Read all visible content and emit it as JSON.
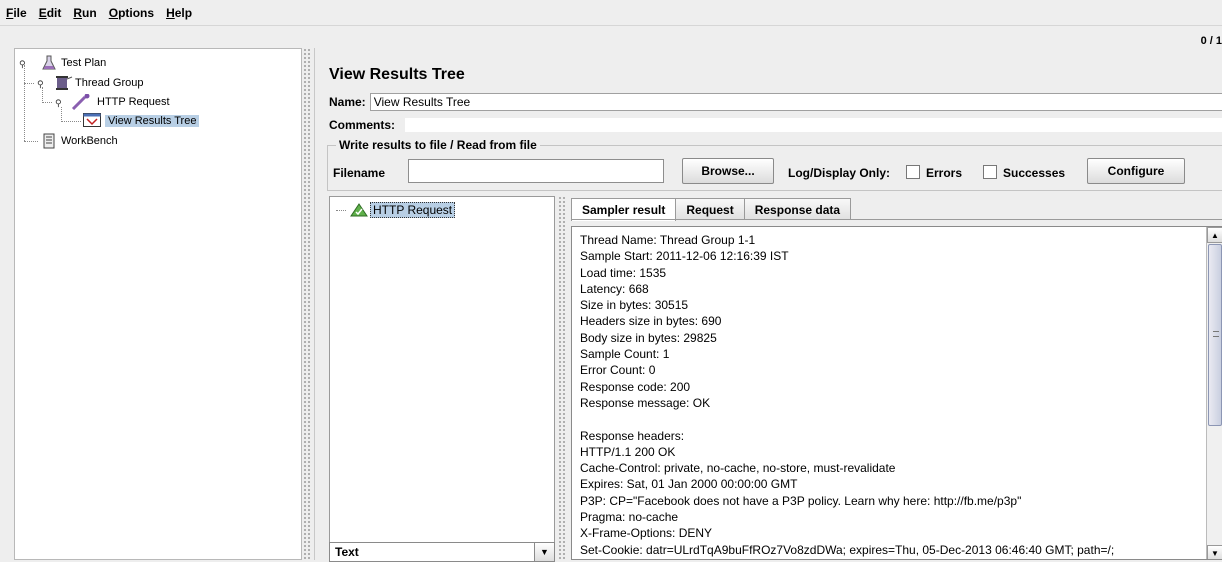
{
  "menu": [
    {
      "u": "F",
      "rest": "ile"
    },
    {
      "u": "E",
      "rest": "dit"
    },
    {
      "u": "R",
      "rest": "un"
    },
    {
      "u": "O",
      "rest": "ptions"
    },
    {
      "u": "H",
      "rest": "elp"
    }
  ],
  "status": "0 / 1",
  "tree": {
    "test_plan": "Test Plan",
    "thread_group": "Thread Group",
    "http_request": "HTTP Request",
    "view_results_tree": "View Results Tree",
    "workbench": "WorkBench"
  },
  "panel": {
    "title": "View Results Tree",
    "name_label": "Name:",
    "name_value": "View Results Tree",
    "comments_label": "Comments:",
    "file_legend": "Write results to file / Read from file",
    "filename_label": "Filename",
    "browse": "Browse...",
    "log_display": "Log/Display Only:",
    "errors": "Errors",
    "successes": "Successes",
    "configure": "Configure"
  },
  "results": {
    "item": "HTTP Request",
    "renderer": "Text"
  },
  "tabs": [
    "Sampler result",
    "Request",
    "Response data"
  ],
  "response_lines": [
    "Thread Name: Thread Group 1-1",
    "Sample Start: 2011-12-06 12:16:39 IST",
    "Load time: 1535",
    "Latency: 668",
    "Size in bytes: 30515",
    "Headers size in bytes: 690",
    "Body size in bytes: 29825",
    "Sample Count: 1",
    "Error Count: 0",
    "Response code: 200",
    "Response message: OK",
    "",
    "Response headers:",
    "HTTP/1.1 200 OK",
    "Cache-Control: private, no-cache, no-store, must-revalidate",
    "Expires: Sat, 01 Jan 2000 00:00:00 GMT",
    "P3P: CP=\"Facebook does not have a P3P policy. Learn why here: http://fb.me/p3p\"",
    "Pragma: no-cache",
    "X-Frame-Options: DENY",
    "Set-Cookie: datr=ULrdTqA9buFfROz7Vo8zdDWa; expires=Thu, 05-Dec-2013 06:46:40 GMT; path=/;"
  ]
}
